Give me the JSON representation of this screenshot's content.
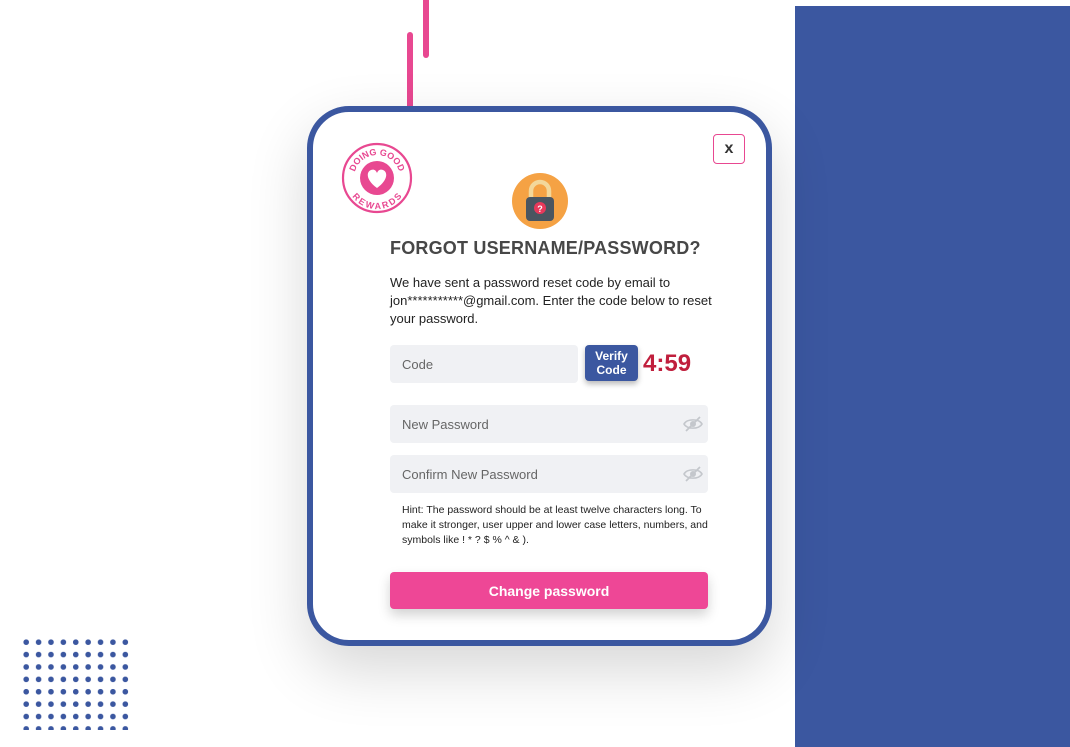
{
  "modal": {
    "logo_text_top": "DOING GOOD",
    "logo_text_bottom": "REWARDS",
    "close_label": "x",
    "title": "FORGOT USERNAME/PASSWORD?",
    "description": "We have sent a password reset code by email to jon***********@gmail.com. Enter the code below to reset your password.",
    "code_placeholder": "Code",
    "verify_label_line1": "Verify",
    "verify_label_line2": "Code",
    "timer": "4:59",
    "new_password_placeholder": "New Password",
    "confirm_password_placeholder": "Confirm New Password",
    "hint": "Hint: The password should be at least twelve characters long. To make it stronger, user upper and lower case letters, numbers, and symbols like ! * ? $ % ^ & ).",
    "submit_label": "Change password"
  },
  "colors": {
    "brand_blue": "#3b57a0",
    "brand_pink": "#e84891",
    "timer_red": "#c01f3d",
    "field_bg": "#f0f1f4"
  },
  "icons": {
    "logo": "heart-badge-icon",
    "lock": "padlock-question-icon",
    "close": "close-icon",
    "visibility": "eye-off-icon"
  }
}
